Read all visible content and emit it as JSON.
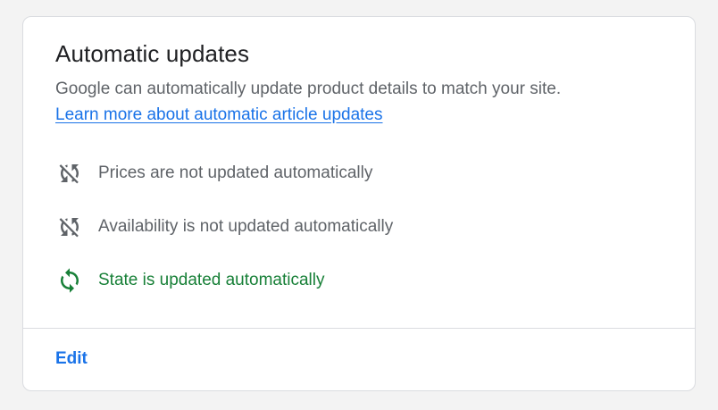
{
  "card": {
    "title": "Automatic updates",
    "description": "Google can automatically update product details to match your site.",
    "learn_more_link": "Learn more about automatic article updates",
    "statuses": [
      {
        "label": "Prices are not updated automatically",
        "icon": "sync-disabled-icon",
        "state": "off"
      },
      {
        "label": "Availability is not updated automatically",
        "icon": "sync-disabled-icon",
        "state": "off"
      },
      {
        "label": "State is updated automatically",
        "icon": "sync-icon",
        "state": "on"
      }
    ],
    "edit_label": "Edit"
  },
  "colors": {
    "primary_text": "#202124",
    "secondary_text": "#5f6368",
    "link": "#1a73e8",
    "success": "#188038",
    "border": "#dadce0"
  }
}
